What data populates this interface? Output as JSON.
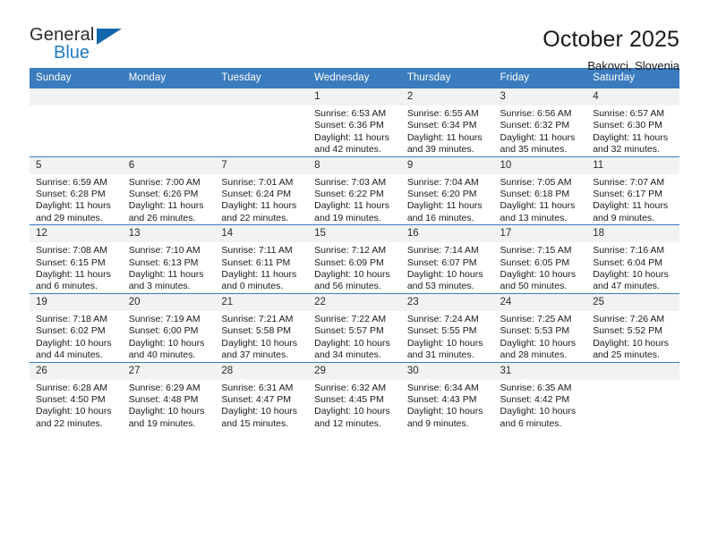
{
  "brand": {
    "name_top": "General",
    "name_bottom": "Blue",
    "accent_color": "#1266ad",
    "text_color": "#2b2b2b"
  },
  "header": {
    "title": "October 2025",
    "subtitle": "Bakovci, Slovenia"
  },
  "calendar": {
    "header_bg": "#3a7cbe",
    "daynum_bg": "#f2f2f2",
    "weekdays": [
      "Sunday",
      "Monday",
      "Tuesday",
      "Wednesday",
      "Thursday",
      "Friday",
      "Saturday"
    ],
    "weeks": [
      [
        {
          "day": "",
          "empty": true,
          "sunrise": "",
          "sunset": "",
          "daylight_line1": "",
          "daylight_line2": ""
        },
        {
          "day": "",
          "empty": true,
          "sunrise": "",
          "sunset": "",
          "daylight_line1": "",
          "daylight_line2": ""
        },
        {
          "day": "",
          "empty": true,
          "sunrise": "",
          "sunset": "",
          "daylight_line1": "",
          "daylight_line2": ""
        },
        {
          "day": "1",
          "empty": false,
          "sunrise": "Sunrise: 6:53 AM",
          "sunset": "Sunset: 6:36 PM",
          "daylight_line1": "Daylight: 11 hours",
          "daylight_line2": "and 42 minutes."
        },
        {
          "day": "2",
          "empty": false,
          "sunrise": "Sunrise: 6:55 AM",
          "sunset": "Sunset: 6:34 PM",
          "daylight_line1": "Daylight: 11 hours",
          "daylight_line2": "and 39 minutes."
        },
        {
          "day": "3",
          "empty": false,
          "sunrise": "Sunrise: 6:56 AM",
          "sunset": "Sunset: 6:32 PM",
          "daylight_line1": "Daylight: 11 hours",
          "daylight_line2": "and 35 minutes."
        },
        {
          "day": "4",
          "empty": false,
          "sunrise": "Sunrise: 6:57 AM",
          "sunset": "Sunset: 6:30 PM",
          "daylight_line1": "Daylight: 11 hours",
          "daylight_line2": "and 32 minutes."
        }
      ],
      [
        {
          "day": "5",
          "empty": false,
          "sunrise": "Sunrise: 6:59 AM",
          "sunset": "Sunset: 6:28 PM",
          "daylight_line1": "Daylight: 11 hours",
          "daylight_line2": "and 29 minutes."
        },
        {
          "day": "6",
          "empty": false,
          "sunrise": "Sunrise: 7:00 AM",
          "sunset": "Sunset: 6:26 PM",
          "daylight_line1": "Daylight: 11 hours",
          "daylight_line2": "and 26 minutes."
        },
        {
          "day": "7",
          "empty": false,
          "sunrise": "Sunrise: 7:01 AM",
          "sunset": "Sunset: 6:24 PM",
          "daylight_line1": "Daylight: 11 hours",
          "daylight_line2": "and 22 minutes."
        },
        {
          "day": "8",
          "empty": false,
          "sunrise": "Sunrise: 7:03 AM",
          "sunset": "Sunset: 6:22 PM",
          "daylight_line1": "Daylight: 11 hours",
          "daylight_line2": "and 19 minutes."
        },
        {
          "day": "9",
          "empty": false,
          "sunrise": "Sunrise: 7:04 AM",
          "sunset": "Sunset: 6:20 PM",
          "daylight_line1": "Daylight: 11 hours",
          "daylight_line2": "and 16 minutes."
        },
        {
          "day": "10",
          "empty": false,
          "sunrise": "Sunrise: 7:05 AM",
          "sunset": "Sunset: 6:18 PM",
          "daylight_line1": "Daylight: 11 hours",
          "daylight_line2": "and 13 minutes."
        },
        {
          "day": "11",
          "empty": false,
          "sunrise": "Sunrise: 7:07 AM",
          "sunset": "Sunset: 6:17 PM",
          "daylight_line1": "Daylight: 11 hours",
          "daylight_line2": "and 9 minutes."
        }
      ],
      [
        {
          "day": "12",
          "empty": false,
          "sunrise": "Sunrise: 7:08 AM",
          "sunset": "Sunset: 6:15 PM",
          "daylight_line1": "Daylight: 11 hours",
          "daylight_line2": "and 6 minutes."
        },
        {
          "day": "13",
          "empty": false,
          "sunrise": "Sunrise: 7:10 AM",
          "sunset": "Sunset: 6:13 PM",
          "daylight_line1": "Daylight: 11 hours",
          "daylight_line2": "and 3 minutes."
        },
        {
          "day": "14",
          "empty": false,
          "sunrise": "Sunrise: 7:11 AM",
          "sunset": "Sunset: 6:11 PM",
          "daylight_line1": "Daylight: 11 hours",
          "daylight_line2": "and 0 minutes."
        },
        {
          "day": "15",
          "empty": false,
          "sunrise": "Sunrise: 7:12 AM",
          "sunset": "Sunset: 6:09 PM",
          "daylight_line1": "Daylight: 10 hours",
          "daylight_line2": "and 56 minutes."
        },
        {
          "day": "16",
          "empty": false,
          "sunrise": "Sunrise: 7:14 AM",
          "sunset": "Sunset: 6:07 PM",
          "daylight_line1": "Daylight: 10 hours",
          "daylight_line2": "and 53 minutes."
        },
        {
          "day": "17",
          "empty": false,
          "sunrise": "Sunrise: 7:15 AM",
          "sunset": "Sunset: 6:05 PM",
          "daylight_line1": "Daylight: 10 hours",
          "daylight_line2": "and 50 minutes."
        },
        {
          "day": "18",
          "empty": false,
          "sunrise": "Sunrise: 7:16 AM",
          "sunset": "Sunset: 6:04 PM",
          "daylight_line1": "Daylight: 10 hours",
          "daylight_line2": "and 47 minutes."
        }
      ],
      [
        {
          "day": "19",
          "empty": false,
          "sunrise": "Sunrise: 7:18 AM",
          "sunset": "Sunset: 6:02 PM",
          "daylight_line1": "Daylight: 10 hours",
          "daylight_line2": "and 44 minutes."
        },
        {
          "day": "20",
          "empty": false,
          "sunrise": "Sunrise: 7:19 AM",
          "sunset": "Sunset: 6:00 PM",
          "daylight_line1": "Daylight: 10 hours",
          "daylight_line2": "and 40 minutes."
        },
        {
          "day": "21",
          "empty": false,
          "sunrise": "Sunrise: 7:21 AM",
          "sunset": "Sunset: 5:58 PM",
          "daylight_line1": "Daylight: 10 hours",
          "daylight_line2": "and 37 minutes."
        },
        {
          "day": "22",
          "empty": false,
          "sunrise": "Sunrise: 7:22 AM",
          "sunset": "Sunset: 5:57 PM",
          "daylight_line1": "Daylight: 10 hours",
          "daylight_line2": "and 34 minutes."
        },
        {
          "day": "23",
          "empty": false,
          "sunrise": "Sunrise: 7:24 AM",
          "sunset": "Sunset: 5:55 PM",
          "daylight_line1": "Daylight: 10 hours",
          "daylight_line2": "and 31 minutes."
        },
        {
          "day": "24",
          "empty": false,
          "sunrise": "Sunrise: 7:25 AM",
          "sunset": "Sunset: 5:53 PM",
          "daylight_line1": "Daylight: 10 hours",
          "daylight_line2": "and 28 minutes."
        },
        {
          "day": "25",
          "empty": false,
          "sunrise": "Sunrise: 7:26 AM",
          "sunset": "Sunset: 5:52 PM",
          "daylight_line1": "Daylight: 10 hours",
          "daylight_line2": "and 25 minutes."
        }
      ],
      [
        {
          "day": "26",
          "empty": false,
          "sunrise": "Sunrise: 6:28 AM",
          "sunset": "Sunset: 4:50 PM",
          "daylight_line1": "Daylight: 10 hours",
          "daylight_line2": "and 22 minutes."
        },
        {
          "day": "27",
          "empty": false,
          "sunrise": "Sunrise: 6:29 AM",
          "sunset": "Sunset: 4:48 PM",
          "daylight_line1": "Daylight: 10 hours",
          "daylight_line2": "and 19 minutes."
        },
        {
          "day": "28",
          "empty": false,
          "sunrise": "Sunrise: 6:31 AM",
          "sunset": "Sunset: 4:47 PM",
          "daylight_line1": "Daylight: 10 hours",
          "daylight_line2": "and 15 minutes."
        },
        {
          "day": "29",
          "empty": false,
          "sunrise": "Sunrise: 6:32 AM",
          "sunset": "Sunset: 4:45 PM",
          "daylight_line1": "Daylight: 10 hours",
          "daylight_line2": "and 12 minutes."
        },
        {
          "day": "30",
          "empty": false,
          "sunrise": "Sunrise: 6:34 AM",
          "sunset": "Sunset: 4:43 PM",
          "daylight_line1": "Daylight: 10 hours",
          "daylight_line2": "and 9 minutes."
        },
        {
          "day": "31",
          "empty": false,
          "sunrise": "Sunrise: 6:35 AM",
          "sunset": "Sunset: 4:42 PM",
          "daylight_line1": "Daylight: 10 hours",
          "daylight_line2": "and 6 minutes."
        },
        {
          "day": "",
          "empty": true,
          "sunrise": "",
          "sunset": "",
          "daylight_line1": "",
          "daylight_line2": ""
        }
      ]
    ]
  }
}
